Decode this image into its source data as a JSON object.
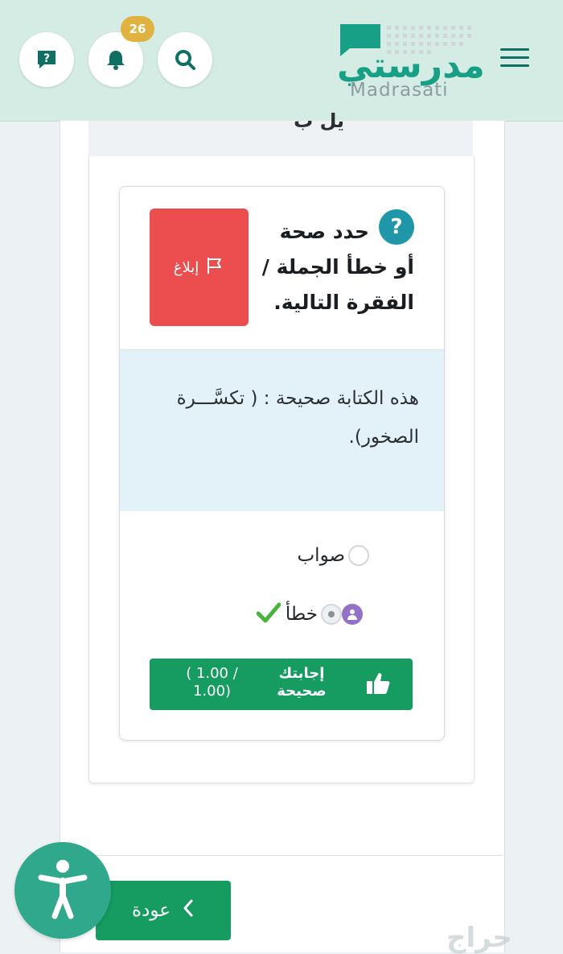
{
  "header": {
    "notification_count": "26",
    "logo_arabic": "مدرستي",
    "logo_latin": "Madrasati"
  },
  "section": {
    "partial_title": "يل ب"
  },
  "question": {
    "text": "حدد صحة أو خطأ الجملة / الفقرة التالية.",
    "report_label": "إبلاغ",
    "stem": "هذه الكتابة صحيحة : ( تكسَّـــرة الصخور).",
    "options": [
      {
        "label": "صواب",
        "selected": false
      },
      {
        "label": "خطأ",
        "selected": true
      }
    ],
    "result_label": "إجابتك صحيحة",
    "result_score": "( 1.00 / 1.00)"
  },
  "footer": {
    "back_label": "عودة",
    "watermark": "حراج"
  },
  "colors": {
    "header_bg": "#d4ece4",
    "brand_teal": "#17a085",
    "success_green": "#169b60",
    "report_red": "#ec4d4f",
    "badge_gold": "#e0b341",
    "stem_bg": "#e3f2f8"
  },
  "icons": [
    "help-icon",
    "bell-icon",
    "search-icon",
    "menu-icon",
    "question-mark-icon",
    "flag-icon",
    "user-icon",
    "checkmark-icon",
    "thumbs-up-icon",
    "chevron-left-icon",
    "accessibility-icon"
  ]
}
